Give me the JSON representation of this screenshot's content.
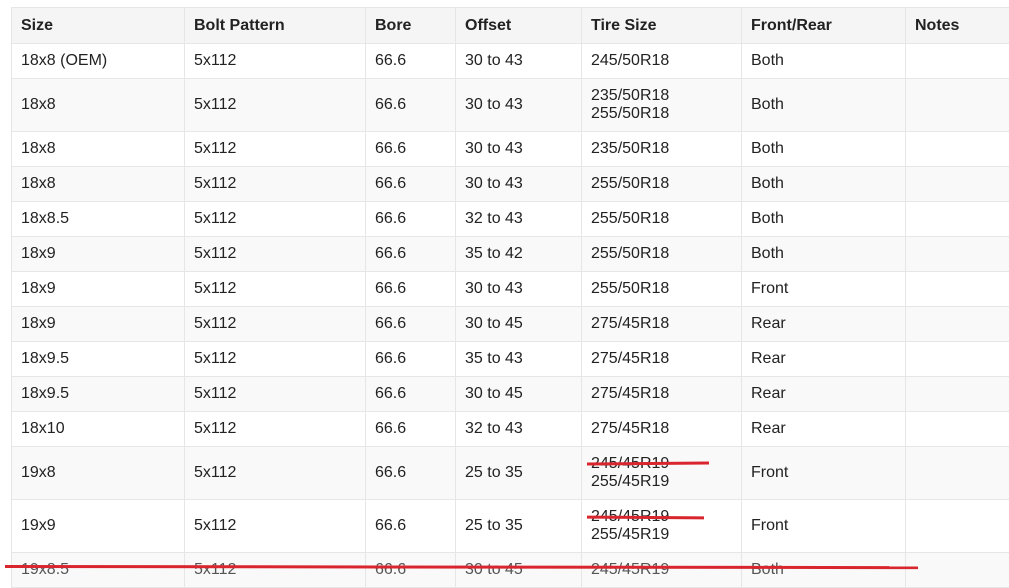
{
  "table": {
    "headers": [
      "Size",
      "Bolt Pattern",
      "Bore",
      "Offset",
      "Tire Size",
      "Front/Rear",
      "Notes"
    ],
    "rows": [
      {
        "size": "18x8 (OEM)",
        "bolt": "5x112",
        "bore": "66.6",
        "offset": "30 to 43",
        "tires": [
          "245/50R18"
        ],
        "position": "Both",
        "notes": ""
      },
      {
        "size": "18x8",
        "bolt": "5x112",
        "bore": "66.6",
        "offset": "30 to 43",
        "tires": [
          "235/50R18",
          "255/50R18"
        ],
        "position": "Both",
        "notes": ""
      },
      {
        "size": "18x8",
        "bolt": "5x112",
        "bore": "66.6",
        "offset": "30 to 43",
        "tires": [
          "235/50R18"
        ],
        "position": "Both",
        "notes": ""
      },
      {
        "size": "18x8",
        "bolt": "5x112",
        "bore": "66.6",
        "offset": "30 to 43",
        "tires": [
          "255/50R18"
        ],
        "position": "Both",
        "notes": ""
      },
      {
        "size": "18x8.5",
        "bolt": "5x112",
        "bore": "66.6",
        "offset": "32 to 43",
        "tires": [
          "255/50R18"
        ],
        "position": "Both",
        "notes": ""
      },
      {
        "size": "18x9",
        "bolt": "5x112",
        "bore": "66.6",
        "offset": "35 to 42",
        "tires": [
          "255/50R18"
        ],
        "position": "Both",
        "notes": ""
      },
      {
        "size": "18x9",
        "bolt": "5x112",
        "bore": "66.6",
        "offset": "30 to 43",
        "tires": [
          "255/50R18"
        ],
        "position": "Front",
        "notes": ""
      },
      {
        "size": "18x9",
        "bolt": "5x112",
        "bore": "66.6",
        "offset": "30 to 45",
        "tires": [
          "275/45R18"
        ],
        "position": "Rear",
        "notes": ""
      },
      {
        "size": "18x9.5",
        "bolt": "5x112",
        "bore": "66.6",
        "offset": "35 to 43",
        "tires": [
          "275/45R18"
        ],
        "position": "Rear",
        "notes": ""
      },
      {
        "size": "18x9.5",
        "bolt": "5x112",
        "bore": "66.6",
        "offset": "30 to 45",
        "tires": [
          "275/45R18"
        ],
        "position": "Rear",
        "notes": ""
      },
      {
        "size": "18x10",
        "bolt": "5x112",
        "bore": "66.6",
        "offset": "32 to 43",
        "tires": [
          "275/45R18"
        ],
        "position": "Rear",
        "notes": ""
      },
      {
        "size": "19x8",
        "bolt": "5x112",
        "bore": "66.6",
        "offset": "25 to 35",
        "tires": [
          "245/45R19",
          "255/45R19"
        ],
        "position": "Front",
        "notes": ""
      },
      {
        "size": "19x9",
        "bolt": "5x112",
        "bore": "66.6",
        "offset": "25 to 35",
        "tires": [
          "245/45R19",
          "255/45R19"
        ],
        "position": "Front",
        "notes": ""
      },
      {
        "size": "19x8.5",
        "bolt": "5x112",
        "bore": "66.6",
        "offset": "30 to 45",
        "tires": [
          "245/45R19"
        ],
        "position": "Both",
        "notes": ""
      }
    ]
  },
  "annotations": {
    "strike_color": "#d9262e"
  }
}
